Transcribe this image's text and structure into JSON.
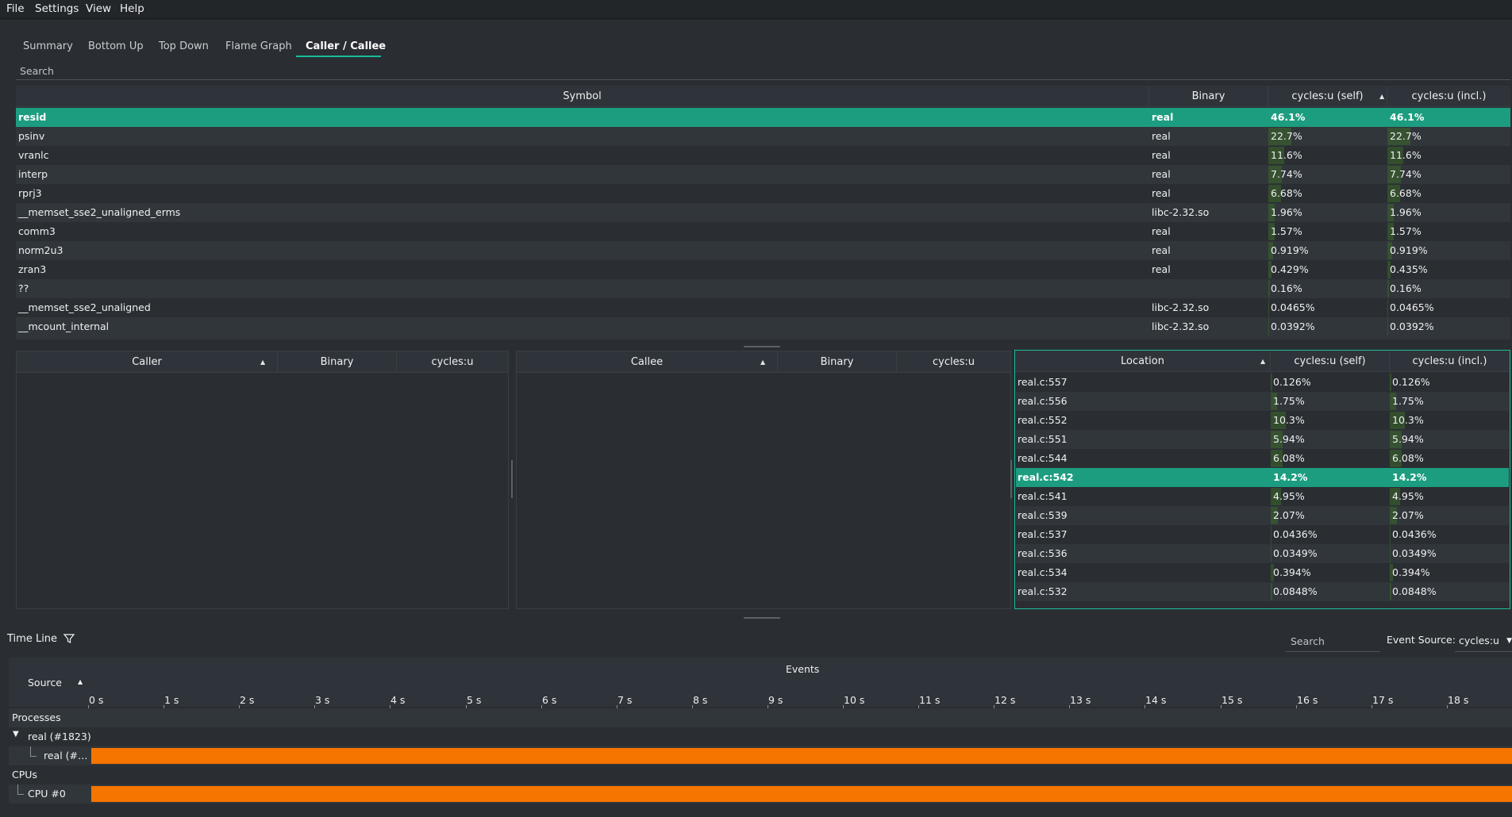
{
  "menu": [
    "File",
    "Settings",
    "View",
    "Help"
  ],
  "tabs": [
    "Summary",
    "Bottom Up",
    "Top Down",
    "Flame Graph",
    "Caller / Callee"
  ],
  "search": {
    "placeholder": "Search"
  },
  "symbol_table": {
    "headers": {
      "symbol": "Symbol",
      "binary": "Binary",
      "self": "cycles:u (self)",
      "incl": "cycles:u (incl.)"
    },
    "rows": [
      {
        "symbol": "resid",
        "binary": "real",
        "self": "46.1%",
        "incl": "46.1%",
        "selected": true,
        "self_frac": 0.461,
        "incl_frac": 0.461
      },
      {
        "symbol": "psinv",
        "binary": "real",
        "self": "22.7%",
        "incl": "22.7%",
        "self_frac": 0.227,
        "incl_frac": 0.227
      },
      {
        "symbol": "vranlc",
        "binary": "real",
        "self": "11.6%",
        "incl": "11.6%",
        "self_frac": 0.116,
        "incl_frac": 0.116
      },
      {
        "symbol": "interp",
        "binary": "real",
        "self": "7.74%",
        "incl": "7.74%",
        "self_frac": 0.0774,
        "incl_frac": 0.0774
      },
      {
        "symbol": "rprj3",
        "binary": "real",
        "self": "6.68%",
        "incl": "6.68%",
        "self_frac": 0.0668,
        "incl_frac": 0.0668
      },
      {
        "symbol": "__memset_sse2_unaligned_erms",
        "binary": "libc-2.32.so",
        "self": "1.96%",
        "incl": "1.96%",
        "self_frac": 0.0196,
        "incl_frac": 0.0196
      },
      {
        "symbol": "comm3",
        "binary": "real",
        "self": "1.57%",
        "incl": "1.57%",
        "self_frac": 0.0157,
        "incl_frac": 0.0157
      },
      {
        "symbol": "norm2u3",
        "binary": "real",
        "self": "0.919%",
        "incl": "0.919%",
        "self_frac": 0.00919,
        "incl_frac": 0.00919
      },
      {
        "symbol": "zran3",
        "binary": "real",
        "self": "0.429%",
        "incl": "0.435%",
        "self_frac": 0.00429,
        "incl_frac": 0.00435
      },
      {
        "symbol": "??",
        "binary": "",
        "self": "0.16%",
        "incl": "0.16%",
        "self_frac": 0.0016,
        "incl_frac": 0.0016
      },
      {
        "symbol": "__memset_sse2_unaligned",
        "binary": "libc-2.32.so",
        "self": "0.0465%",
        "incl": "0.0465%",
        "self_frac": 0.000465,
        "incl_frac": 0.000465
      },
      {
        "symbol": "__mcount_internal",
        "binary": "libc-2.32.so",
        "self": "0.0392%",
        "incl": "0.0392%",
        "self_frac": 0.000392,
        "incl_frac": 0.000392
      }
    ]
  },
  "caller_table": {
    "headers": {
      "name": "Caller",
      "binary": "Binary",
      "cost": "cycles:u"
    }
  },
  "callee_table": {
    "headers": {
      "name": "Callee",
      "binary": "Binary",
      "cost": "cycles:u"
    }
  },
  "location_table": {
    "headers": {
      "location": "Location",
      "self": "cycles:u (self)",
      "incl": "cycles:u (incl.)"
    },
    "rows": [
      {
        "location": "real.c:557",
        "self": "0.126%",
        "incl": "0.126%",
        "self_frac": 0.00126
      },
      {
        "location": "real.c:556",
        "self": "1.75%",
        "incl": "1.75%",
        "self_frac": 0.0175
      },
      {
        "location": "real.c:552",
        "self": "10.3%",
        "incl": "10.3%",
        "self_frac": 0.103
      },
      {
        "location": "real.c:551",
        "self": "5.94%",
        "incl": "5.94%",
        "self_frac": 0.0594
      },
      {
        "location": "real.c:544",
        "self": "6.08%",
        "incl": "6.08%",
        "self_frac": 0.0608
      },
      {
        "location": "real.c:542",
        "self": "14.2%",
        "incl": "14.2%",
        "selected": true,
        "self_frac": 0.142
      },
      {
        "location": "real.c:541",
        "self": "4.95%",
        "incl": "4.95%",
        "self_frac": 0.0495
      },
      {
        "location": "real.c:539",
        "self": "2.07%",
        "incl": "2.07%",
        "self_frac": 0.0207
      },
      {
        "location": "real.c:537",
        "self": "0.0436%",
        "incl": "0.0436%",
        "self_frac": 0.000436
      },
      {
        "location": "real.c:536",
        "self": "0.0349%",
        "incl": "0.0349%",
        "self_frac": 0.000349
      },
      {
        "location": "real.c:534",
        "self": "0.394%",
        "incl": "0.394%",
        "self_frac": 0.00394
      },
      {
        "location": "real.c:532",
        "self": "0.0848%",
        "incl": "0.0848%",
        "self_frac": 0.000848
      }
    ]
  },
  "timeline": {
    "title": "Time Line",
    "search_placeholder": "Search",
    "event_source_label": "Event Source:",
    "event_source_value": "cycles:u",
    "source_header": "Source",
    "events_header": "Events",
    "ticks": [
      "0 s",
      "1 s",
      "2 s",
      "3 s",
      "4 s",
      "5 s",
      "6 s",
      "7 s",
      "8 s",
      "9 s",
      "10 s",
      "11 s",
      "12 s",
      "13 s",
      "14 s",
      "15 s",
      "16 s",
      "17 s",
      "18 s"
    ],
    "processes_label": "Processes",
    "process_name": "real (#1823)",
    "thread_name": "real (#…",
    "cpus_label": "CPUs",
    "cpu_name": "CPU #0",
    "bar_color": "#f67400",
    "accent": "#1abc9c"
  }
}
